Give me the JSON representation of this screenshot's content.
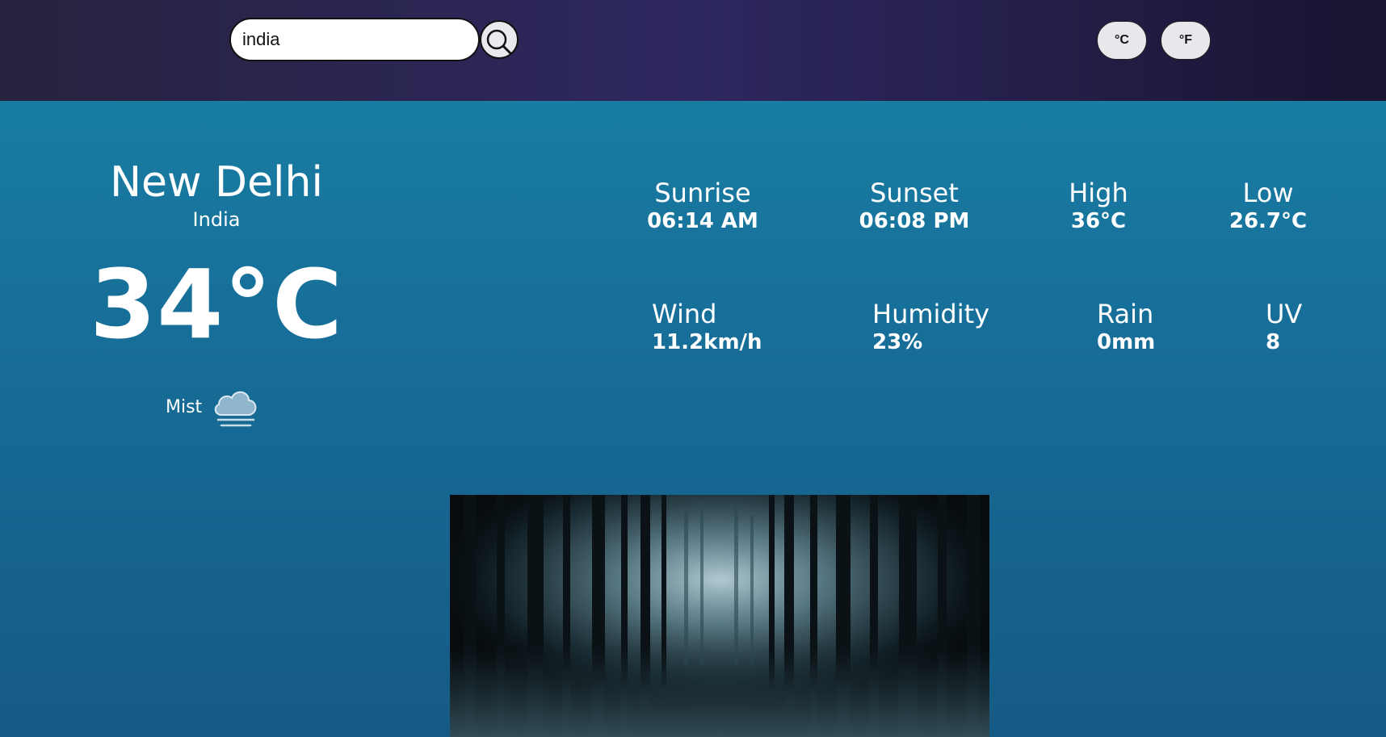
{
  "search": {
    "value": "india",
    "icon": "search-icon"
  },
  "units": {
    "celsius_label": "°C",
    "fahrenheit_label": "°F"
  },
  "location": {
    "city": "New Delhi",
    "country": "India"
  },
  "current": {
    "temperature": "34°C",
    "condition": "Mist",
    "condition_icon": "mist-cloud-icon"
  },
  "stats": {
    "sunrise": {
      "label": "Sunrise",
      "value": "06:14 AM"
    },
    "sunset": {
      "label": "Sunset",
      "value": "06:08 PM"
    },
    "high": {
      "label": "High",
      "value": "36°C"
    },
    "low": {
      "label": "Low",
      "value": "26.7°C"
    },
    "wind": {
      "label": "Wind",
      "value": "11.2km/h"
    },
    "humidity": {
      "label": "Humidity",
      "value": "23%"
    },
    "rain": {
      "label": "Rain",
      "value": "0mm"
    },
    "uv": {
      "label": "UV",
      "value": "8"
    }
  },
  "colors": {
    "header_start": "#26233f",
    "header_mid": "#2e2860",
    "body_top": "#1a84a6",
    "body_bottom": "#155a85"
  }
}
